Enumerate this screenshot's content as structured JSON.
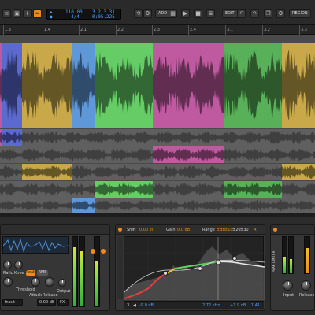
{
  "toolbar": {
    "tempo": "110.00",
    "signature": "4/4",
    "position_bars": "3.2.3.31",
    "position_time": "0:05.225",
    "add_label": "ADD",
    "edit_label": "EDIT",
    "region_label": "REGION",
    "accent": "#f08a1c"
  },
  "ruler": {
    "ticks": [
      "1.3",
      "1.4",
      "2.1",
      "2.2",
      "2.3",
      "2.4",
      "3.1",
      "3.2",
      "3.3"
    ]
  },
  "tracks": {
    "main_clip_colors": [
      "#c05aa0",
      "#5c6ad0",
      "#c9a84a",
      "#5e98d8",
      "#66cc66",
      "#c05aa0",
      "#58b058",
      "#c9a84a"
    ]
  },
  "eq": {
    "shift_label": "Shift",
    "shift_value": "0.00 st",
    "gain_label": "Gain",
    "gain_value": "0.0 dB",
    "range_label": "Range",
    "range_db": "±dB",
    "range_10": "±10",
    "range_20": "±20",
    "range_30": "±30",
    "ab_label": "A",
    "band_number": "3",
    "band_gain": "-9.0 dB",
    "frequency": "2.72 kHz",
    "gain": "+1.9 dB",
    "q": "1.41",
    "band_labels": [
      "-9.0 dB",
      "2.72 kHz",
      "+1.9 dB",
      "1.41"
    ]
  },
  "compressor": {
    "ratio_label": "Ratio",
    "knee_label": "Knee",
    "peak_label": "Peak",
    "rms_label": "RMS",
    "threshold_label": "Threshold",
    "attack_label": "Attack",
    "release_label": "Release",
    "output_label": "Output",
    "input_label": "Input",
    "threshold_value": "0.00 dB",
    "fx_label": "FX"
  },
  "peak_limiter": {
    "title": "PEAK LIMITER",
    "input_label": "Input",
    "release_label": "Release"
  }
}
